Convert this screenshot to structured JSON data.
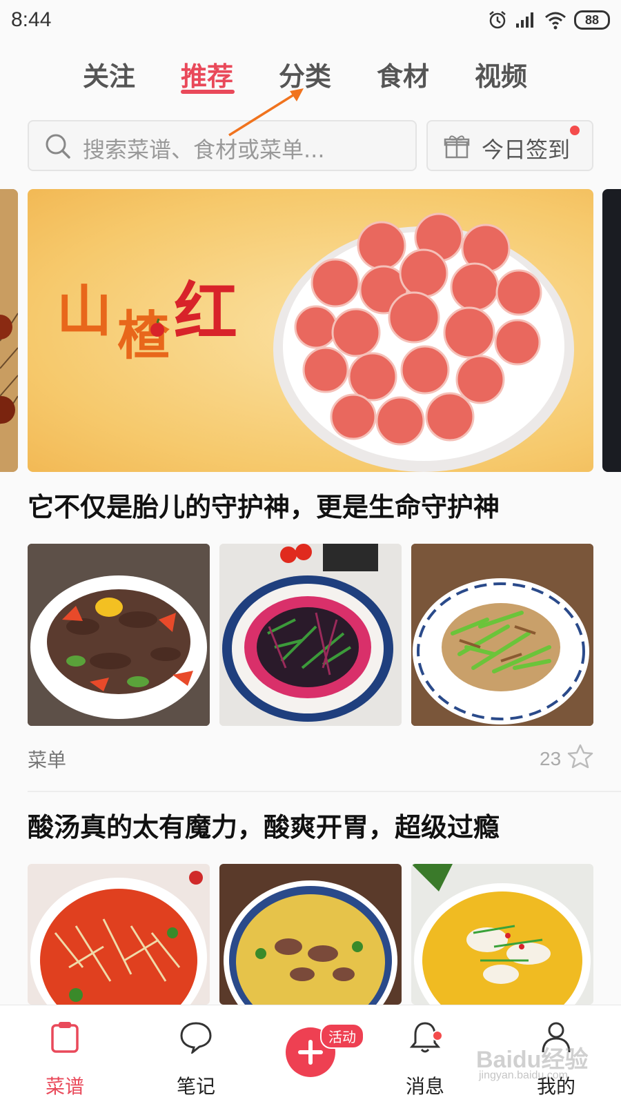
{
  "status_bar": {
    "time": "8:44",
    "battery": "88"
  },
  "top_tabs": {
    "items": [
      "关注",
      "推荐",
      "分类",
      "食材",
      "视频"
    ],
    "active": "推荐"
  },
  "search": {
    "placeholder": "搜索菜谱、食材或菜单..."
  },
  "signin": {
    "label": "今日签到"
  },
  "banner": {
    "chars": [
      "山",
      "楂",
      "红"
    ]
  },
  "sections": [
    {
      "title": "它不仅是胎儿的守护神，更是生命守护神",
      "type_label": "菜单",
      "count": "23"
    },
    {
      "title": "酸汤真的太有魔力，酸爽开胃，超级过瘾"
    }
  ],
  "bottom_nav": {
    "items": [
      "菜谱",
      "笔记",
      "消息",
      "我的"
    ],
    "fab_badge": "活动"
  },
  "watermark": {
    "main": "Baidu经验",
    "sub": "jingyan.baidu.com"
  },
  "colors": {
    "accent": "#e9495a",
    "annotation_arrow": "#f0731e"
  }
}
